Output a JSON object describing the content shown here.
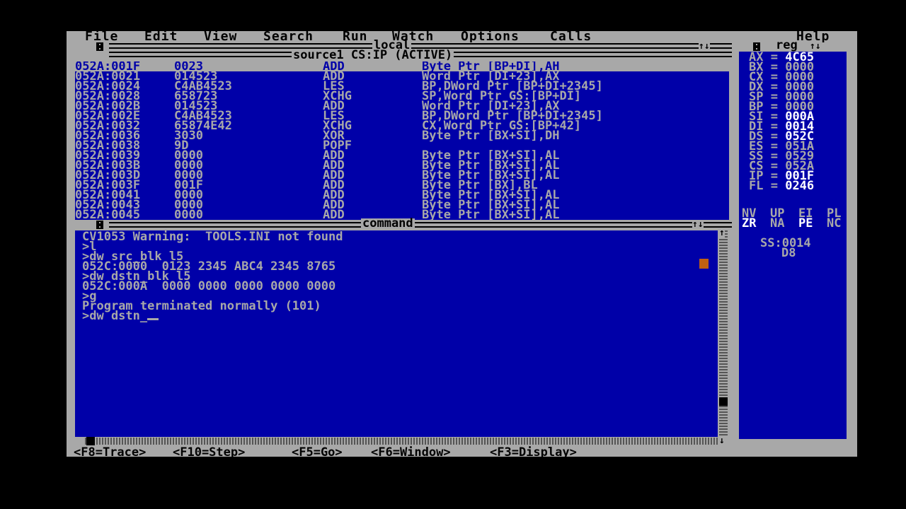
{
  "menu": [
    "File",
    "Edit",
    "View",
    "Search",
    "Run",
    "Watch",
    "Options",
    "Calls",
    "Help"
  ],
  "local_title": "local",
  "source_title": "source1 CS:IP (ACTIVE)",
  "reg_title": "reg",
  "command_title": "command",
  "source_rows": [
    {
      "addr": "052A:001F",
      "bytes": "0023",
      "op": "ADD",
      "args": "Byte Ptr [BP+DI],AH"
    },
    {
      "addr": "052A:0021",
      "bytes": "014523",
      "op": "ADD",
      "args": "Word Ptr [DI+23],AX"
    },
    {
      "addr": "052A:0024",
      "bytes": "C4AB4523",
      "op": "LES",
      "args": "BP,DWord Ptr [BP+DI+2345]"
    },
    {
      "addr": "052A:0028",
      "bytes": "658723",
      "op": "XCHG",
      "args": "SP,Word Ptr GS:[BP+DI]"
    },
    {
      "addr": "052A:002B",
      "bytes": "014523",
      "op": "ADD",
      "args": "Word Ptr [DI+23],AX"
    },
    {
      "addr": "052A:002E",
      "bytes": "C4AB4523",
      "op": "LES",
      "args": "BP,DWord Ptr [BP+DI+2345]"
    },
    {
      "addr": "052A:0032",
      "bytes": "65874E42",
      "op": "XCHG",
      "args": "CX,Word Ptr GS:[BP+42]"
    },
    {
      "addr": "052A:0036",
      "bytes": "3030",
      "op": "XOR",
      "args": "Byte Ptr [BX+SI],DH"
    },
    {
      "addr": "052A:0038",
      "bytes": "9D",
      "op": "POPF",
      "args": ""
    },
    {
      "addr": "052A:0039",
      "bytes": "0000",
      "op": "ADD",
      "args": "Byte Ptr [BX+SI],AL"
    },
    {
      "addr": "052A:003B",
      "bytes": "0000",
      "op": "ADD",
      "args": "Byte Ptr [BX+SI],AL"
    },
    {
      "addr": "052A:003D",
      "bytes": "0000",
      "op": "ADD",
      "args": "Byte Ptr [BX+SI],AL"
    },
    {
      "addr": "052A:003F",
      "bytes": "001F",
      "op": "ADD",
      "args": "Byte Ptr [BX],BL"
    },
    {
      "addr": "052A:0041",
      "bytes": "0000",
      "op": "ADD",
      "args": "Byte Ptr [BX+SI],AL"
    },
    {
      "addr": "052A:0043",
      "bytes": "0000",
      "op": "ADD",
      "args": "Byte Ptr [BX+SI],AL"
    },
    {
      "addr": "052A:0045",
      "bytes": "0000",
      "op": "ADD",
      "args": "Byte Ptr [BX+SI],AL"
    }
  ],
  "command_lines": [
    "CV1053 Warning:  TOOLS.INI not found",
    ">l",
    ">dw src_blk l5",
    "052C:0000  0123 2345 ABC4 2345 8765",
    ">dw dstn_blk l5",
    "052C:000A  0000 0000 0000 0000 0000",
    ">g",
    "Program terminated normally (101)"
  ],
  "command_input": ">dw dstn_",
  "registers": [
    {
      "name": "AX",
      "value": "4C65",
      "changed": true
    },
    {
      "name": "BX",
      "value": "0000",
      "changed": false
    },
    {
      "name": "CX",
      "value": "0000",
      "changed": false
    },
    {
      "name": "DX",
      "value": "0000",
      "changed": false
    },
    {
      "name": "SP",
      "value": "0000",
      "changed": false
    },
    {
      "name": "BP",
      "value": "0000",
      "changed": false
    },
    {
      "name": "SI",
      "value": "000A",
      "changed": true
    },
    {
      "name": "DI",
      "value": "0014",
      "changed": true
    },
    {
      "name": "DS",
      "value": "052C",
      "changed": true
    },
    {
      "name": "ES",
      "value": "051A",
      "changed": false
    },
    {
      "name": "SS",
      "value": "0529",
      "changed": false
    },
    {
      "name": "CS",
      "value": "052A",
      "changed": false
    },
    {
      "name": "IP",
      "value": "001F",
      "changed": true
    },
    {
      "name": "FL",
      "value": "0246",
      "changed": true
    }
  ],
  "flags_row1": [
    {
      "text": "NV",
      "changed": false
    },
    {
      "text": "UP",
      "changed": false
    },
    {
      "text": "EI",
      "changed": false
    },
    {
      "text": "PL",
      "changed": false
    }
  ],
  "flags_row2": [
    {
      "text": "ZR",
      "changed": true
    },
    {
      "text": "NA",
      "changed": false
    },
    {
      "text": "PE",
      "changed": true
    },
    {
      "text": "NC",
      "changed": false
    }
  ],
  "stack_addr": "SS:0014",
  "stack_value": "D8",
  "status": [
    "<F8=Trace>",
    "<F10=Step>",
    "<F5=Go>",
    "<F6=Window>",
    "<F3=Display>"
  ],
  "colors": {
    "screen": "#000000",
    "frame": "#a8a8a8",
    "pane": "#0000a8",
    "text": "#a8a8a8",
    "highlight": "#ffffff",
    "marker": "#c06010"
  }
}
